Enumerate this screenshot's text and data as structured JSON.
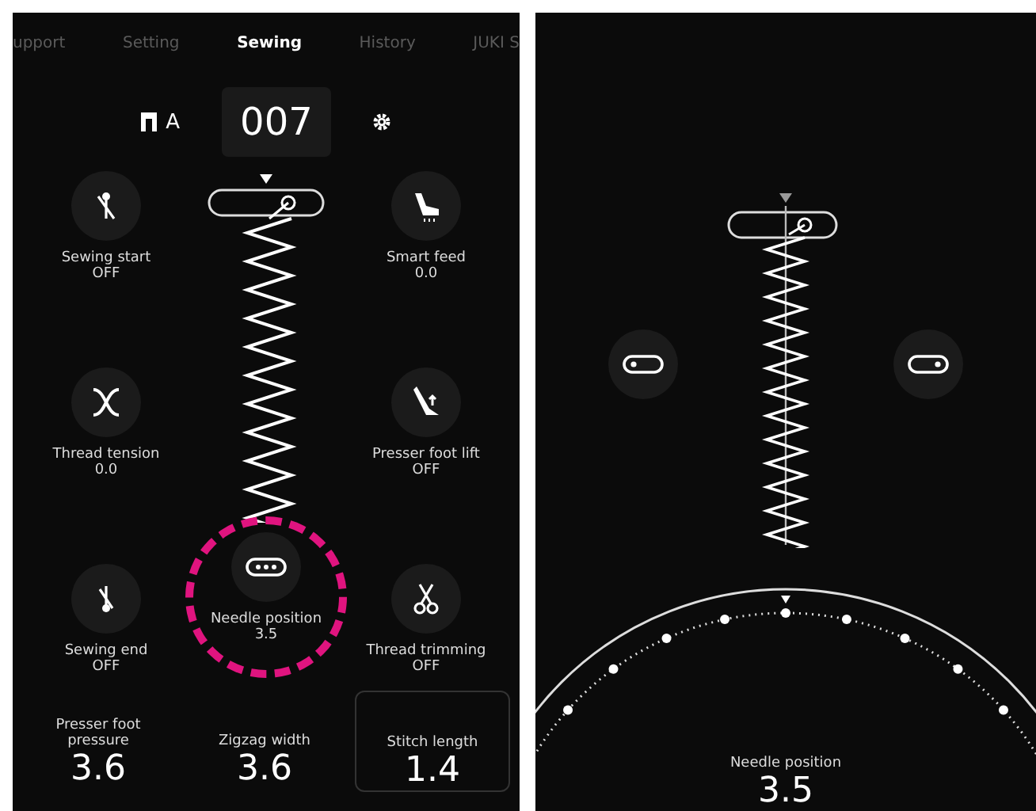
{
  "tabs": [
    {
      "label": "upport",
      "selected": false
    },
    {
      "label": "Setting",
      "selected": false
    },
    {
      "label": "Sewing",
      "selected": true
    },
    {
      "label": "History",
      "selected": false
    },
    {
      "label": "JUKI S",
      "selected": false
    }
  ],
  "header": {
    "foot_letter": "A",
    "pattern_number": "007"
  },
  "left_settings": [
    {
      "kind": "start",
      "label": "Sewing start",
      "value": "OFF"
    },
    {
      "kind": "tension",
      "label": "Thread tension",
      "value": "0.0"
    },
    {
      "kind": "end",
      "label": "Sewing end",
      "value": "OFF"
    }
  ],
  "right_settings": [
    {
      "kind": "feed",
      "label": "Smart feed",
      "value": "0.0"
    },
    {
      "kind": "lift",
      "label": "Presser foot lift",
      "value": "OFF"
    },
    {
      "kind": "trim",
      "label": "Thread trimming",
      "value": "OFF"
    }
  ],
  "needle_position": {
    "label": "Needle position",
    "value": "3.5",
    "highlighted": true
  },
  "bottom_values": [
    {
      "label": "Presser foot pressure",
      "value": "3.6",
      "framed": false
    },
    {
      "label": "Zigzag width",
      "value": "3.6",
      "framed": false
    },
    {
      "label": "Stitch length",
      "value": "1.4",
      "framed": true
    }
  ],
  "detail": {
    "label": "Needle position",
    "value": "3.5"
  }
}
